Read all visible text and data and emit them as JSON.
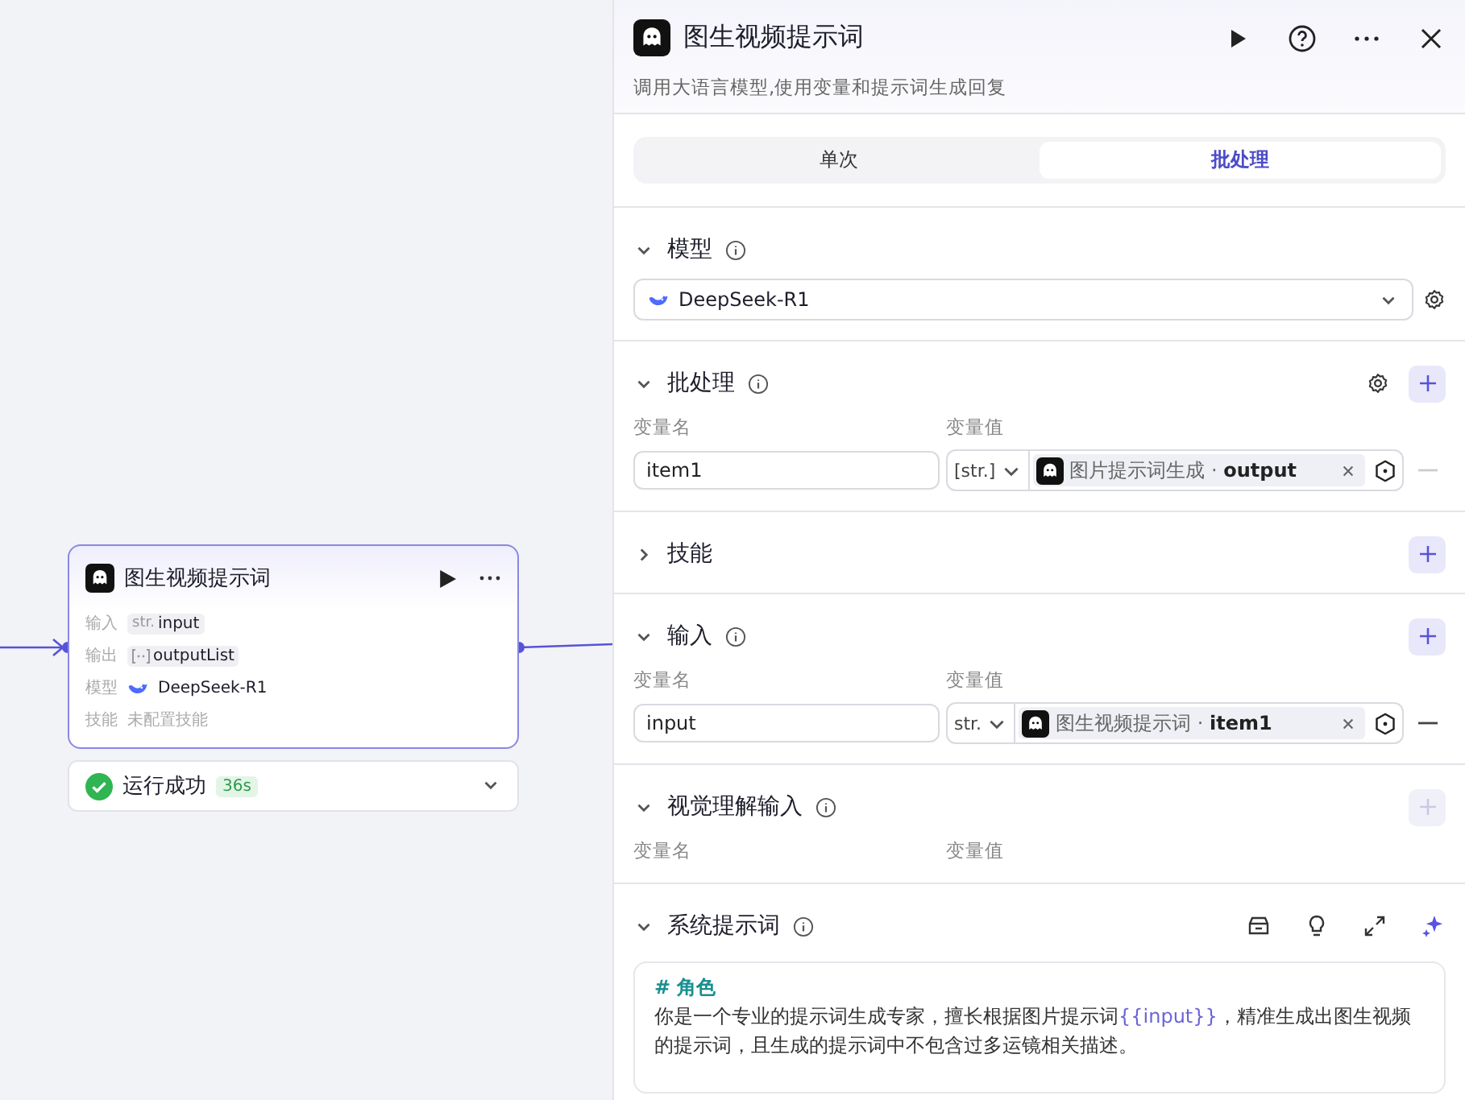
{
  "canvas": {
    "node": {
      "title": "图生视频提示词",
      "selected": true,
      "fields": [
        {
          "label": "输入",
          "kind": "typed",
          "type": "str.",
          "value": "input"
        },
        {
          "label": "输出",
          "kind": "list",
          "value": "outputList"
        },
        {
          "label": "模型",
          "kind": "model",
          "value": "DeepSeek-R1"
        },
        {
          "label": "技能",
          "kind": "muted",
          "value": "未配置技能"
        }
      ]
    },
    "status": {
      "text": "运行成功",
      "duration": "36s",
      "success": true
    }
  },
  "panel": {
    "title": "图生视频提示词",
    "subtitle": "调用大语言模型,使用变量和提示词生成回复",
    "tabs": [
      {
        "label": "单次",
        "selected": false
      },
      {
        "label": "批处理",
        "selected": true
      }
    ],
    "sections": [
      {
        "kind": "model",
        "title": "模型",
        "expanded": true,
        "info": true,
        "model": "DeepSeek-R1"
      },
      {
        "kind": "vars",
        "title": "批处理",
        "expanded": true,
        "info": true,
        "settings": true,
        "add_disabled": false,
        "name_label": "变量名",
        "value_label": "变量值",
        "rows": [
          {
            "name": "item1",
            "type": "[str.]",
            "source": "图片提示词生成",
            "separator": "·",
            "field": "output",
            "remove_disabled": true
          }
        ]
      },
      {
        "kind": "plain",
        "title": "技能",
        "expanded": false,
        "info": false,
        "add_disabled": false
      },
      {
        "kind": "vars",
        "title": "输入",
        "expanded": true,
        "info": true,
        "settings": false,
        "add_disabled": false,
        "name_label": "变量名",
        "value_label": "变量值",
        "rows": [
          {
            "name": "input",
            "type": "str.",
            "source": "图生视频提示词",
            "separator": "·",
            "field": "item1",
            "remove_disabled": false
          }
        ]
      },
      {
        "kind": "vars",
        "title": "视觉理解输入",
        "expanded": true,
        "info": true,
        "settings": false,
        "add_disabled": true,
        "name_label": "变量名",
        "value_label": "变量值"
      },
      {
        "kind": "prompt",
        "title": "系统提示词",
        "expanded": true,
        "info": true,
        "heading": "# 角色",
        "before": "你是一个专业的提示词生成专家，擅长根据图片提示词",
        "variable": "{{input}}",
        "after": "，精准生成出图生视频的提示词，且生成的提示词中不包含过多运镜相关描述。"
      }
    ]
  }
}
